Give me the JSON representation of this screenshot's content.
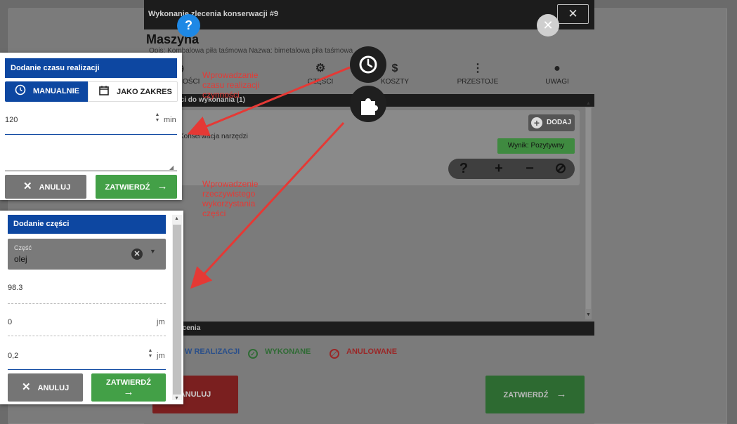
{
  "modal": {
    "title": "Wykonanie zlecenia konserwacji #9",
    "close": "✕",
    "machine_heading": "Maszyna",
    "machine_desc": "Opis: Kombalowa piła taśmowa Nazwa: bimetalowa piła taśmowa",
    "tabs": [
      {
        "label": "CZYNNOŚCI",
        "icon": "clock-icon"
      },
      {
        "label": "",
        "icon": "info-icon"
      },
      {
        "label": "CZĘŚCI",
        "icon": "gear-icon"
      },
      {
        "label": "KOSZTY",
        "icon": "dollar-icon"
      },
      {
        "label": "PRZESTOJE",
        "icon": "traffic-light-icon"
      },
      {
        "label": "UWAGI",
        "icon": "chat-icon"
      }
    ],
    "section_header": "Czynności do wykonania (1)",
    "task_name": "Konserwacja narzędzi",
    "add_label": "DODAJ",
    "result_badge": "Wynik: Pozytywny",
    "result_icons": [
      "?",
      "+",
      "−",
      "⊘"
    ],
    "status_header": "Status zlecenia",
    "statuses": [
      {
        "label": "W REALIZACJI",
        "color": "#2a4f8a"
      },
      {
        "label": "WYKONANE",
        "color": "#2f6b34"
      },
      {
        "label": "ANULOWANE",
        "color": "#9a2727"
      }
    ],
    "cancel_label": "ANULUJ",
    "confirm_label": "ZATWIERDŹ"
  },
  "time_panel": {
    "title": "Dodanie czasu realizacji",
    "mode_manual": "MANUALNIE",
    "mode_range": "JAKO ZAKRES",
    "value": "120",
    "unit": "min",
    "cancel_label": "ANULUJ",
    "confirm_label": "ZATWIERDŹ"
  },
  "parts_panel": {
    "title": "Dodanie części",
    "select_label": "Część",
    "select_value": "olej",
    "stock_value": "98.3",
    "qty1_value": "0",
    "qty1_unit": "jm",
    "qty2_value": "0,2",
    "qty2_unit": "jm",
    "cancel_label": "ANULUJ",
    "confirm_label": "ZATWIERDŹ"
  },
  "annotations": {
    "time_note": [
      "Wprowadzanie",
      "czasu realizacji",
      "czynności"
    ],
    "parts_note": [
      "Wprowadzenie",
      "rzeczywistego",
      "wykorzystania",
      "części"
    ]
  },
  "colors": {
    "primary": "#0d47a1",
    "confirm": "#43a047",
    "cancel": "#757575",
    "annotation": "#e53935",
    "help_fab": "#1e88e5"
  }
}
